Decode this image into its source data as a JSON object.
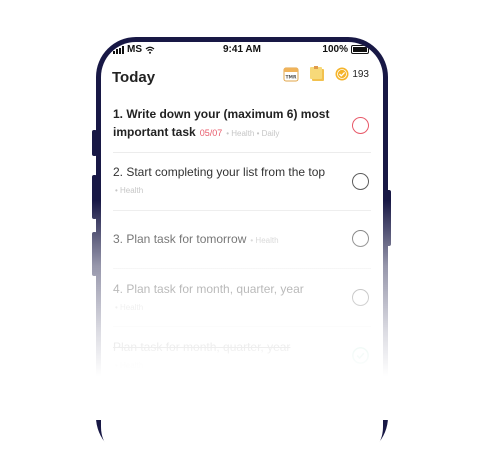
{
  "status_bar": {
    "carrier": "MS",
    "time": "9:41 AM",
    "battery": "100%"
  },
  "header": {
    "title": "Today",
    "coin_count": "193"
  },
  "icons": {
    "calendar": "calendar-icon",
    "sticky_note": "sticky-note-icon",
    "coin": "coin-icon",
    "calendar_label": "TMR"
  },
  "colors": {
    "phone_frame": "#181845",
    "accent_red": "#e85a6a",
    "coin": "#f5b42a",
    "done_green": "#6cc7a8"
  },
  "tasks": [
    {
      "title": "1. Write down your (maximum 6) most important task",
      "due": "05/07",
      "meta": "• Health • Daily",
      "status": "urgent"
    },
    {
      "title": "2. Start completing your list from the top",
      "meta": "• Health",
      "status": "open"
    },
    {
      "title": "3. Plan task for tomorrow",
      "meta": "• Health",
      "status": "open"
    },
    {
      "title": "4. Plan task for month, quarter, year",
      "meta": "• Health",
      "status": "open"
    },
    {
      "title": "Plan task for month, quarter, year",
      "meta": "• Health",
      "status": "done"
    }
  ]
}
